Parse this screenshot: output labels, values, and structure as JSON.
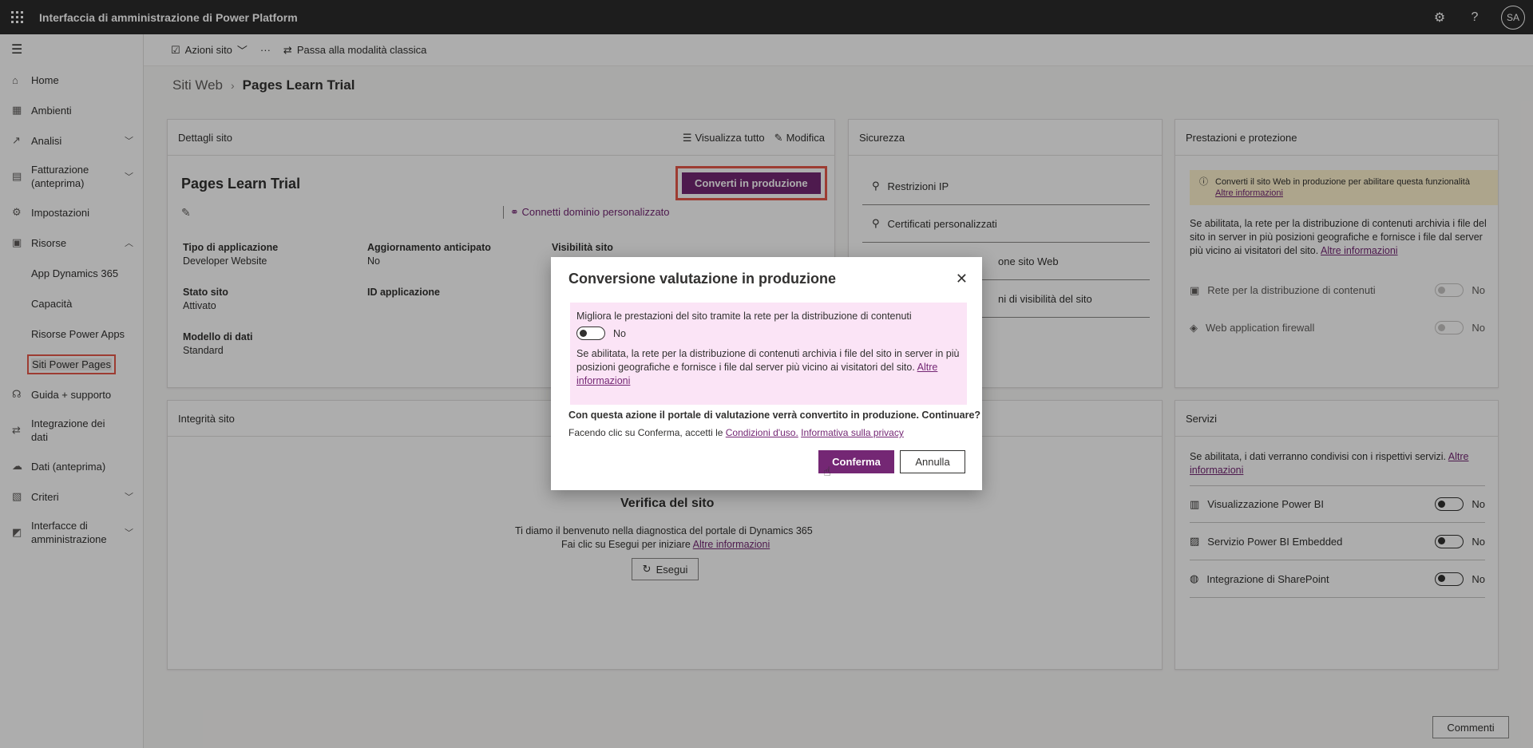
{
  "topbar": {
    "title": "Interfaccia di amministrazione di Power Platform",
    "avatar": "SA"
  },
  "sidebar": {
    "items": [
      {
        "label": "Home"
      },
      {
        "label": "Ambienti"
      },
      {
        "label": "Analisi"
      },
      {
        "label": "Fatturazione (anteprima)"
      },
      {
        "label": "Impostazioni"
      },
      {
        "label": "Risorse"
      },
      {
        "label": "App Dynamics 365"
      },
      {
        "label": "Capacità"
      },
      {
        "label": "Risorse Power Apps"
      },
      {
        "label": "Siti Power Pages"
      },
      {
        "label": "Guida + supporto"
      },
      {
        "label": "Integrazione dei dati"
      },
      {
        "label": "Dati (anteprima)"
      },
      {
        "label": "Criteri"
      },
      {
        "label": "Interfacce di amministrazione"
      }
    ]
  },
  "cmdbar": {
    "site_actions": "Azioni sito",
    "more": "···",
    "classic": "Passa alla modalità classica"
  },
  "breadcrumb": {
    "root": "Siti Web",
    "current": "Pages Learn Trial"
  },
  "details": {
    "title": "Dettagli sito",
    "view_all": "Visualizza tutto",
    "edit": "Modifica",
    "site_name": "Pages Learn Trial",
    "convert": "Converti in produzione",
    "custom_domain": "Connetti dominio personalizzato",
    "fields": [
      {
        "label": "Tipo di applicazione",
        "value": "Developer Website"
      },
      {
        "label": "Aggiornamento anticipato",
        "value": "No"
      },
      {
        "label": "Visibilità sito",
        "value": ""
      },
      {
        "label": "Stato sito",
        "value": "Attivato"
      },
      {
        "label": "ID applicazione",
        "value": ""
      },
      {
        "label": "Modello di dati",
        "value": "Standard"
      }
    ]
  },
  "security": {
    "title": "Sicurezza",
    "items": [
      "Restrizioni IP",
      "Certificati personalizzati",
      "one sito Web",
      "ni di visibilità del sito"
    ]
  },
  "performance": {
    "title": "Prestazioni e protezione",
    "warning": "Converti il sito Web in produzione per abilitare questa funzionalità",
    "warning_link": "Altre informazioni",
    "desc": "Se abilitata, la rete per la distribuzione di contenuti archivia i file del sito in server in più posizioni geografiche e fornisce i file dal server più vicino ai visitatori del sito.",
    "desc_link": "Altre informazioni",
    "cdn": {
      "label": "Rete per la distribuzione di contenuti",
      "value": "No"
    },
    "waf": {
      "label": "Web application firewall",
      "value": "No"
    }
  },
  "health": {
    "title": "Integrità sito",
    "heading": "Verifica del sito",
    "line1": "Ti diamo il benvenuto nella diagnostica del portale di Dynamics 365",
    "line2": "Fai clic su Esegui per iniziare",
    "link": "Altre informazioni",
    "run": "Esegui"
  },
  "services": {
    "title": "Servizi",
    "desc": "Se abilitata, i dati verranno condivisi con i rispettivi servizi.",
    "desc_link": "Altre informazioni",
    "items": [
      {
        "label": "Visualizzazione Power BI",
        "value": "No"
      },
      {
        "label": "Servizio Power BI Embedded",
        "value": "No"
      },
      {
        "label": "Integrazione di SharePoint",
        "value": "No"
      }
    ]
  },
  "comments": "Commenti",
  "dialog": {
    "title": "Conversione valutazione in produzione",
    "cdn_label": "Migliora le prestazioni del sito tramite la rete per la distribuzione di contenuti",
    "cdn_value": "No",
    "cdn_desc": "Se abilitata, la rete per la distribuzione di contenuti archivia i file del sito in server in più posizioni geografiche e fornisce i file dal server più vicino ai visitatori del sito.",
    "cdn_link": "Altre informazioni",
    "question": "Con questa azione il portale di valutazione verrà convertito in produzione. Continuare?",
    "terms_prefix": "Facendo clic su Conferma, accetti le",
    "terms_link": "Condizioni d'uso.",
    "privacy_link": "Informativa sulla privacy",
    "confirm": "Conferma",
    "cancel": "Annulla"
  },
  "colors": {
    "accent": "#742774",
    "highlight": "#e8594a",
    "topbar": "#2b2b2b",
    "pink": "#fbe4f6",
    "warning": "#fff4ce"
  }
}
